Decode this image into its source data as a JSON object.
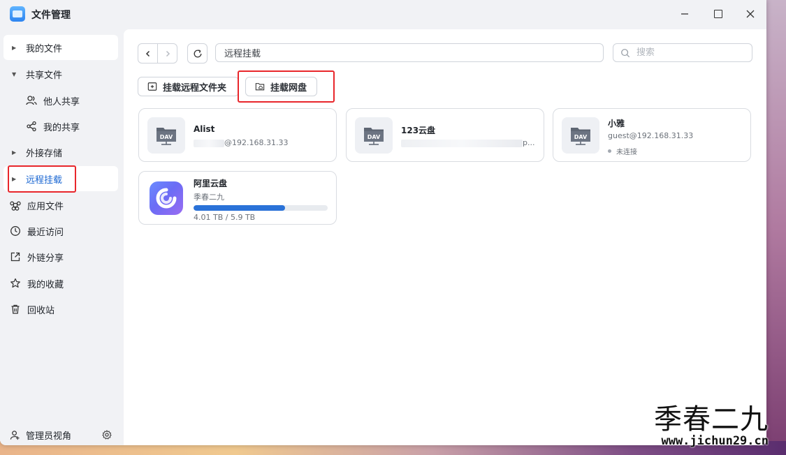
{
  "app": {
    "title": "文件管理"
  },
  "sidebar": {
    "items": [
      {
        "label": "我的文件",
        "type": "caret-right"
      },
      {
        "label": "共享文件",
        "type": "caret-down"
      },
      {
        "label": "他人共享",
        "type": "sub",
        "icon": "users-icon"
      },
      {
        "label": "我的共享",
        "type": "sub",
        "icon": "share-icon"
      },
      {
        "label": "外接存储",
        "type": "caret-right"
      },
      {
        "label": "远程挂载",
        "type": "caret-right",
        "active": true
      },
      {
        "label": "应用文件",
        "icon": "command-icon"
      },
      {
        "label": "最近访问",
        "icon": "clock-icon"
      },
      {
        "label": "外链分享",
        "icon": "external-link-icon"
      },
      {
        "label": "我的收藏",
        "icon": "star-icon"
      },
      {
        "label": "回收站",
        "icon": "trash-icon"
      }
    ],
    "footer": {
      "label": "管理员视角"
    }
  },
  "toolbar": {
    "path": "远程挂载",
    "search_placeholder": "搜索"
  },
  "actions": {
    "mount_remote_folder": "挂载远程文件夹",
    "mount_cloud_drive": "挂载网盘"
  },
  "mounts": [
    {
      "name": "Alist",
      "address_visible": "@192.168.31.33",
      "icon": "DAV"
    },
    {
      "name": "123云盘",
      "address_visible": "p...",
      "icon": "DAV"
    },
    {
      "name": "小雅",
      "address": "guest@192.168.31.33",
      "status": "未连接",
      "icon": "DAV"
    },
    {
      "name": "阿里云盘",
      "account": "季春二九",
      "used_fraction": 0.6797,
      "capacity": "4.01 TB / 5.9 TB",
      "icon": "aliyun-drive-logo"
    }
  ],
  "colors": {
    "accent": "#1966d2",
    "highlight_box": "#e8262b",
    "progress": "#2a72d8"
  },
  "watermark": {
    "text": "季春二九",
    "url": "www.jichun29.cn"
  }
}
